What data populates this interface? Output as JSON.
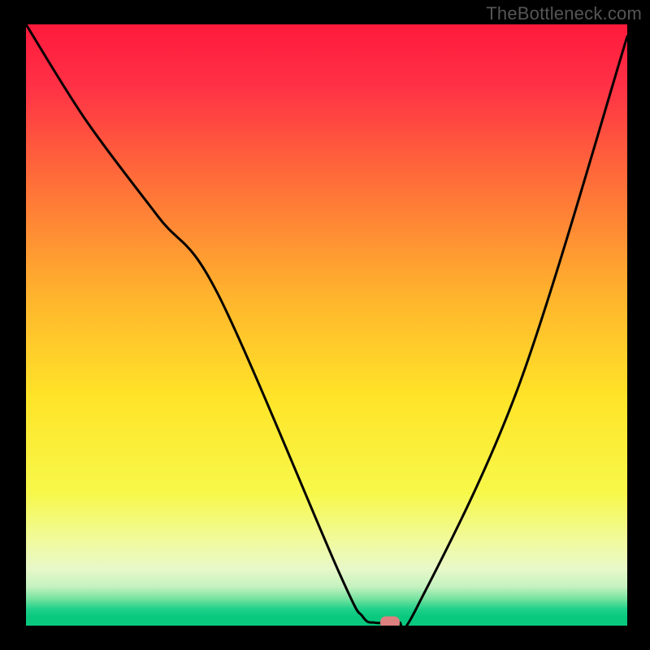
{
  "watermark": "TheBottleneck.com",
  "chart_data": {
    "type": "line",
    "title": "",
    "xlabel": "",
    "ylabel": "",
    "xlim": [
      0,
      100
    ],
    "ylim": [
      0,
      100
    ],
    "grid": false,
    "legend": false,
    "gradient_stops": [
      {
        "pos": 0.0,
        "color": "#ff1a3c"
      },
      {
        "pos": 0.1,
        "color": "#ff3046"
      },
      {
        "pos": 0.25,
        "color": "#ff6a3a"
      },
      {
        "pos": 0.45,
        "color": "#ffb32d"
      },
      {
        "pos": 0.62,
        "color": "#ffe428"
      },
      {
        "pos": 0.78,
        "color": "#f7f84a"
      },
      {
        "pos": 0.86,
        "color": "#f0fa9e"
      },
      {
        "pos": 0.905,
        "color": "#e8f8c8"
      },
      {
        "pos": 0.935,
        "color": "#c5f2c0"
      },
      {
        "pos": 0.955,
        "color": "#78e3a0"
      },
      {
        "pos": 0.972,
        "color": "#21d18a"
      },
      {
        "pos": 0.985,
        "color": "#09c97f"
      },
      {
        "pos": 1.0,
        "color": "#09c97f"
      }
    ],
    "series": [
      {
        "name": "bottleneck-curve",
        "color": "#000000",
        "x": [
          0,
          10,
          22,
          32,
          52,
          56,
          58,
          60,
          62,
          65,
          82,
          100
        ],
        "y": [
          100,
          84,
          68,
          55,
          9,
          1.5,
          0.5,
          0.5,
          0.5,
          3,
          40,
          98
        ]
      }
    ],
    "marker": {
      "x": 60.5,
      "y": 0.5,
      "color": "#dd8080"
    },
    "annotations": []
  }
}
